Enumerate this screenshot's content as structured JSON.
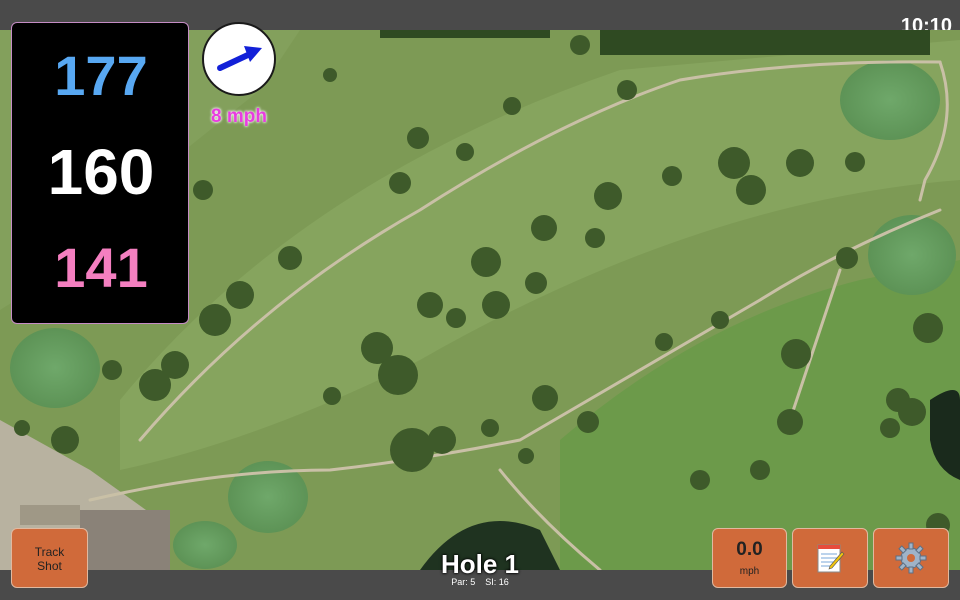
{
  "status": {
    "time": "10:10"
  },
  "distances": {
    "back": "177",
    "middle": "160",
    "front": "141"
  },
  "wind": {
    "speed": "8 mph",
    "direction_icon": "wind-arrow-icon"
  },
  "hole": {
    "title": "Hole 1",
    "par": "Par: 5",
    "stroke_index": "SI: 16"
  },
  "buttons": {
    "track_shot_line1": "Track",
    "track_shot_line2": "Shot",
    "speed_value": "0.0",
    "speed_unit": "mph",
    "notes_icon": "notepad-icon",
    "settings_icon": "gear-icon"
  },
  "colors": {
    "back_distance": "#58a8f2",
    "middle_distance": "#ffffff",
    "front_distance": "#f47fc0",
    "wind_text": "#e83ce0",
    "button": "#d06a3a"
  }
}
